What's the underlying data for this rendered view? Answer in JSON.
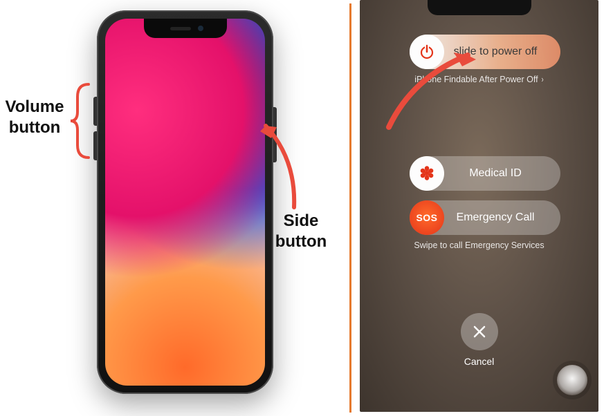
{
  "left": {
    "volume_label": "Volume button",
    "side_label": "Side button"
  },
  "right": {
    "power_off_text": "slide to power off",
    "findable_text": "iPhone Findable After Power Off",
    "medical_text": "Medical ID",
    "sos_knob": "SOS",
    "emergency_text": "Emergency Call",
    "swipe_text": "Swipe to call Emergency Services",
    "cancel_text": "Cancel"
  },
  "colors": {
    "annotation": "#e94b3c",
    "divider": "#e57a2e"
  }
}
